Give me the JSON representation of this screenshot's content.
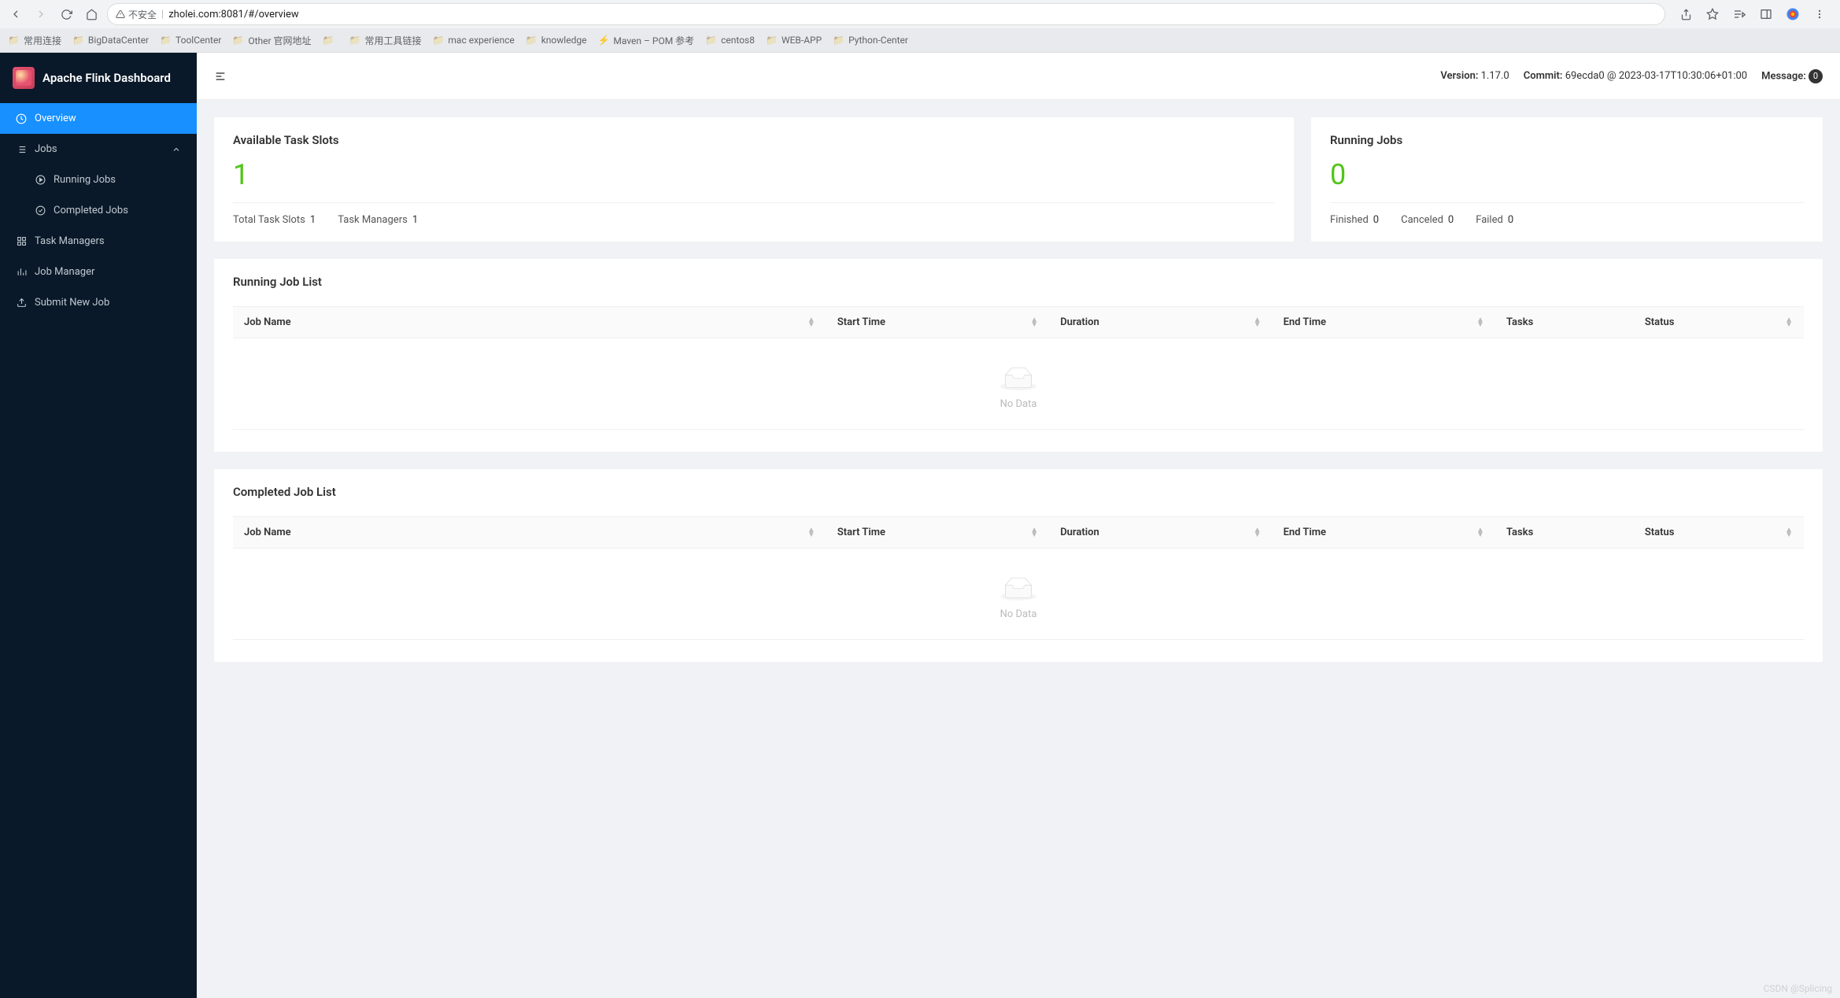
{
  "browser": {
    "url_security": "不安全",
    "url": "zholei.com:8081/#/overview",
    "bookmarks": [
      "常用连接",
      "BigDataCenter",
      "ToolCenter",
      "Other 官网地址",
      "",
      "常用工具链接",
      "mac experience",
      "knowledge",
      "Maven – POM 参考",
      "centos8",
      "WEB-APP",
      "Python-Center"
    ]
  },
  "sidebar": {
    "app_title": "Apache Flink Dashboard",
    "items": {
      "overview": "Overview",
      "jobs": "Jobs",
      "running_jobs": "Running Jobs",
      "completed_jobs": "Completed Jobs",
      "task_managers": "Task Managers",
      "job_manager": "Job Manager",
      "submit_new_job": "Submit New Job"
    }
  },
  "header": {
    "version_label": "Version:",
    "version": "1.17.0",
    "commit_label": "Commit:",
    "commit": "69ecda0 @ 2023-03-17T10:30:06+01:00",
    "message_label": "Message:",
    "message_count": "0"
  },
  "cards": {
    "slots": {
      "title": "Available Task Slots",
      "value": "1",
      "total_label": "Total Task Slots",
      "total_value": "1",
      "managers_label": "Task Managers",
      "managers_value": "1"
    },
    "jobs": {
      "title": "Running Jobs",
      "value": "0",
      "finished_label": "Finished",
      "finished_value": "0",
      "canceled_label": "Canceled",
      "canceled_value": "0",
      "failed_label": "Failed",
      "failed_value": "0"
    }
  },
  "sections": {
    "running_title": "Running Job List",
    "completed_title": "Completed Job List",
    "columns": {
      "job_name": "Job Name",
      "start_time": "Start Time",
      "duration": "Duration",
      "end_time": "End Time",
      "tasks": "Tasks",
      "status": "Status"
    },
    "no_data": "No Data"
  },
  "watermark": "CSDN @Splicing"
}
